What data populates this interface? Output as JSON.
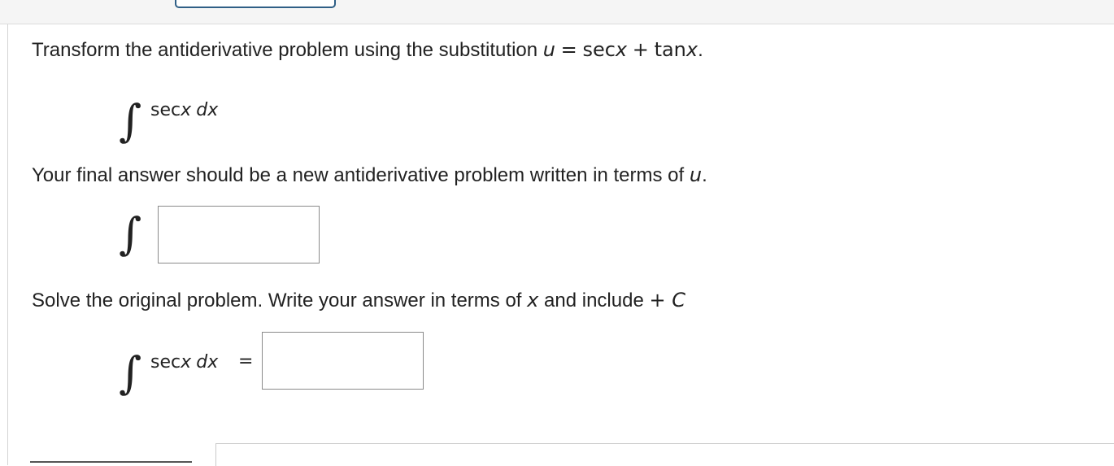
{
  "question": {
    "intro_text": "Transform the antiderivative problem using the substitution",
    "substitution": {
      "var": "u",
      "eq": "=",
      "sec": "sec",
      "x1": "x",
      "plus": "+",
      "tan": "tan",
      "x2": "x",
      "period": "."
    },
    "integral1": {
      "symbol": "∫",
      "func": "sec",
      "var": "x",
      "dx": "dx"
    },
    "instruction_text": "Your final answer should be a new antiderivative problem written in terms of",
    "instruction_var": "u",
    "instruction_period": ".",
    "integral2": {
      "symbol": "∫",
      "answer_value": ""
    },
    "solve_text": "Solve the original problem. Write your answer in terms of",
    "solve_var": "x",
    "solve_text_2": "and include",
    "solve_const": "+ C",
    "integral3": {
      "symbol": "∫",
      "func": "sec",
      "var": "x",
      "dx": "dx",
      "equals": "=",
      "answer_value": ""
    }
  },
  "colors": {
    "top_tab_border": "#2f5f86",
    "text": "#222222",
    "box_border": "#8a8a8a"
  }
}
